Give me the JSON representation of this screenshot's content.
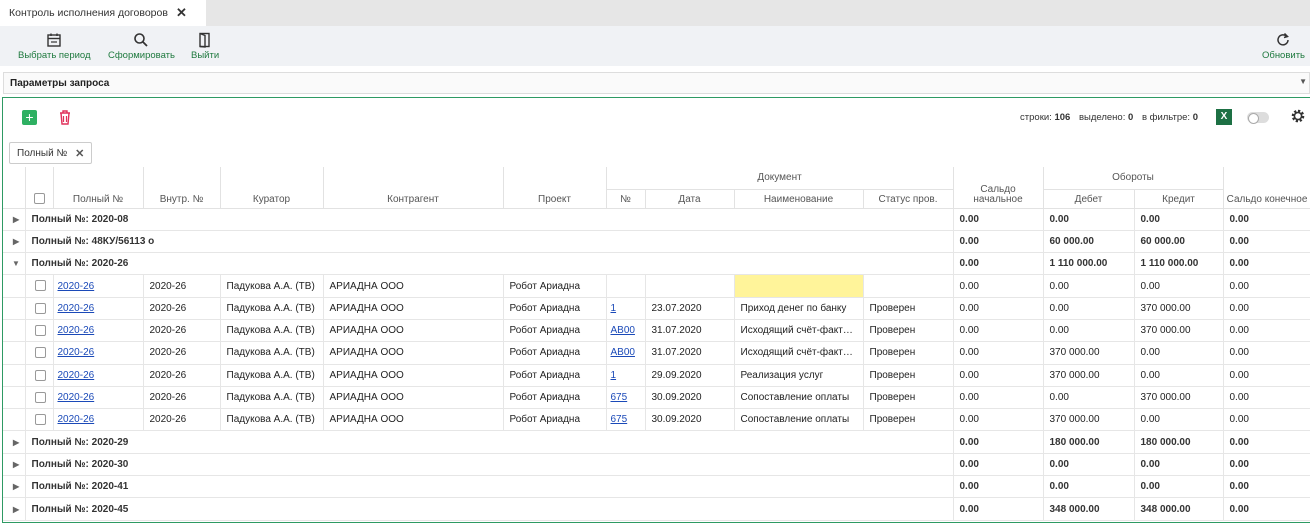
{
  "tab": {
    "title": "Контроль исполнения договоров"
  },
  "toolbar": {
    "choose_period": "Выбрать период",
    "generate": "Сформировать",
    "exit": "Выйти",
    "refresh": "Обновить"
  },
  "params": {
    "label": "Параметры запроса"
  },
  "stats": {
    "rows_label": "строки:",
    "rows": "106",
    "selected_label": "выделено:",
    "selected": "0",
    "filter_label": "в фильтре:",
    "filter": "0",
    "excel": "X"
  },
  "chip": {
    "label": "Полный №"
  },
  "headers": {
    "full_no": "Полный №",
    "inner_no": "Внутр. №",
    "curator": "Куратор",
    "contractor": "Контрагент",
    "project": "Проект",
    "document": "Документ",
    "doc_no": "№",
    "doc_date": "Дата",
    "doc_name": "Наименование",
    "doc_status": "Статус пров.",
    "saldo_start": "Сальдо начальное",
    "turnovers": "Обороты",
    "debit": "Дебет",
    "credit": "Кредит",
    "saldo_end": "Сальдо конечное"
  },
  "groups_top": [
    {
      "label": "Полный №: 2020-08",
      "saldo_start": "0.00",
      "debit": "0.00",
      "credit": "0.00",
      "saldo_end": "0.00"
    },
    {
      "label": "Полный №: 48КУ/56113 о",
      "saldo_start": "0.00",
      "debit": "60 000.00",
      "credit": "60 000.00",
      "saldo_end": "0.00"
    },
    {
      "label": "Полный №: 2020-26",
      "saldo_start": "0.00",
      "debit": "1 110 000.00",
      "credit": "1 110 000.00",
      "saldo_end": "0.00"
    }
  ],
  "rows": [
    {
      "full_no": "2020-26",
      "inner_no": "2020-26",
      "curator": "Падукова А.А. (ТВ)",
      "contractor": "АРИАДНА ООО",
      "project": "Робот Ариадна",
      "doc_no": "",
      "doc_date": "",
      "doc_name": "",
      "doc_status": "",
      "saldo_start": "0.00",
      "debit": "0.00",
      "credit": "0.00",
      "saldo_end": "0.00"
    },
    {
      "full_no": "2020-26",
      "inner_no": "2020-26",
      "curator": "Падукова А.А. (ТВ)",
      "contractor": "АРИАДНА ООО",
      "project": "Робот Ариадна",
      "doc_no": "1",
      "doc_date": "23.07.2020",
      "doc_name": "Приход денег по банку",
      "doc_status": "Проверен",
      "saldo_start": "0.00",
      "debit": "0.00",
      "credit": "370 000.00",
      "saldo_end": "0.00"
    },
    {
      "full_no": "2020-26",
      "inner_no": "2020-26",
      "curator": "Падукова А.А. (ТВ)",
      "contractor": "АРИАДНА ООО",
      "project": "Робот Ариадна",
      "doc_no": "АВ00",
      "doc_date": "31.07.2020",
      "doc_name": "Исходящий счёт-фактура",
      "doc_status": "Проверен",
      "saldo_start": "0.00",
      "debit": "0.00",
      "credit": "370 000.00",
      "saldo_end": "0.00"
    },
    {
      "full_no": "2020-26",
      "inner_no": "2020-26",
      "curator": "Падукова А.А. (ТВ)",
      "contractor": "АРИАДНА ООО",
      "project": "Робот Ариадна",
      "doc_no": "АВ00",
      "doc_date": "31.07.2020",
      "doc_name": "Исходящий счёт-фактура",
      "doc_status": "Проверен",
      "saldo_start": "0.00",
      "debit": "370 000.00",
      "credit": "0.00",
      "saldo_end": "0.00"
    },
    {
      "full_no": "2020-26",
      "inner_no": "2020-26",
      "curator": "Падукова А.А. (ТВ)",
      "contractor": "АРИАДНА ООО",
      "project": "Робот Ариадна",
      "doc_no": "1",
      "doc_date": "29.09.2020",
      "doc_name": "Реализация услуг",
      "doc_status": "Проверен",
      "saldo_start": "0.00",
      "debit": "370 000.00",
      "credit": "0.00",
      "saldo_end": "0.00"
    },
    {
      "full_no": "2020-26",
      "inner_no": "2020-26",
      "curator": "Падукова А.А. (ТВ)",
      "contractor": "АРИАДНА ООО",
      "project": "Робот Ариадна",
      "doc_no": "675",
      "doc_date": "30.09.2020",
      "doc_name": "Сопоставление оплаты",
      "doc_status": "Проверен",
      "saldo_start": "0.00",
      "debit": "0.00",
      "credit": "370 000.00",
      "saldo_end": "0.00"
    },
    {
      "full_no": "2020-26",
      "inner_no": "2020-26",
      "curator": "Падукова А.А. (ТВ)",
      "contractor": "АРИАДНА ООО",
      "project": "Робот Ариадна",
      "doc_no": "675",
      "doc_date": "30.09.2020",
      "doc_name": "Сопоставление оплаты",
      "doc_status": "Проверен",
      "saldo_start": "0.00",
      "debit": "370 000.00",
      "credit": "0.00",
      "saldo_end": "0.00"
    }
  ],
  "groups_bottom": [
    {
      "label": "Полный №: 2020-29",
      "saldo_start": "0.00",
      "debit": "180 000.00",
      "credit": "180 000.00",
      "saldo_end": "0.00"
    },
    {
      "label": "Полный №: 2020-30",
      "saldo_start": "0.00",
      "debit": "0.00",
      "credit": "0.00",
      "saldo_end": "0.00"
    },
    {
      "label": "Полный №: 2020-41",
      "saldo_start": "0.00",
      "debit": "0.00",
      "credit": "0.00",
      "saldo_end": "0.00"
    },
    {
      "label": "Полный №: 2020-45",
      "saldo_start": "0.00",
      "debit": "348 000.00",
      "credit": "348 000.00",
      "saldo_end": "0.00"
    }
  ]
}
